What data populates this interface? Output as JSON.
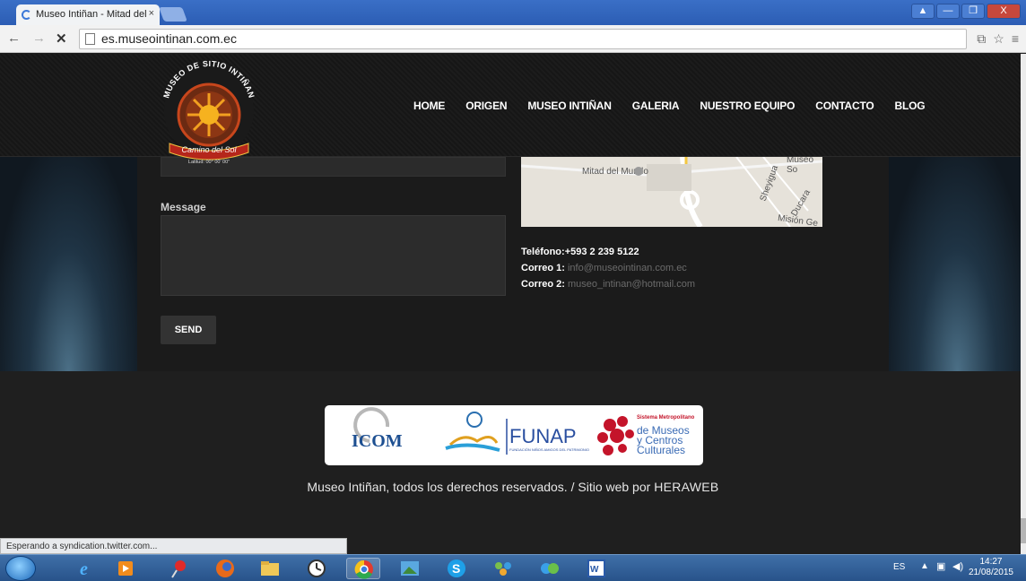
{
  "browser": {
    "tab_title": "Museo Intiñan - Mitad del",
    "tab_close": "×",
    "url": "es.museointinan.com.ec",
    "window_buttons": [
      "▲",
      "—",
      "❐",
      "X"
    ]
  },
  "site": {
    "logo": {
      "top_text": "MUSEO DE SITIO INTIÑAN",
      "ribbon_text": "Camino del Sol",
      "bottom_text": "Latitud: 00° 00' 00\""
    },
    "nav": [
      "HOME",
      "ORIGEN",
      "MUSEO INTIÑAN",
      "GALERIA",
      "NUESTRO EQUIPO",
      "CONTACTO",
      "BLOG"
    ],
    "form": {
      "message_label": "Message",
      "send_label": "SEND"
    },
    "map": {
      "labels": [
        "Mitad del Mundo",
        "Museo So",
        "Sheyigua",
        "Ducara",
        "Misión Ge"
      ]
    },
    "contact": {
      "phone_label": "Teléfono:",
      "phone_value": "+593 2 239 5122",
      "email1_label": "Correo 1:",
      "email1_value": "info@museointinan.com.ec",
      "email2_label": "Correo 2:",
      "email2_value": "museo_intinan@hotmail.com"
    },
    "partners": {
      "icom": "ICOM",
      "funap": "FUNAP",
      "funap_sub": "FUNDACIÓN NIÑOS AMIGOS DEL PATRIMONIO",
      "sistema_title": "Sistema Metropolitano",
      "sistema_line1": "de Museos",
      "sistema_line2": "y Centros",
      "sistema_line3": "Culturales"
    },
    "footer": {
      "copyright": "Museo Intiñan, todos los derechos reservados. / Sitio web por ",
      "brand": "HERAWEB"
    }
  },
  "status_text": "Esperando a syndication.twitter.com...",
  "taskbar": {
    "lang": "ES",
    "time": "14:27",
    "date": "21/08/2015"
  }
}
